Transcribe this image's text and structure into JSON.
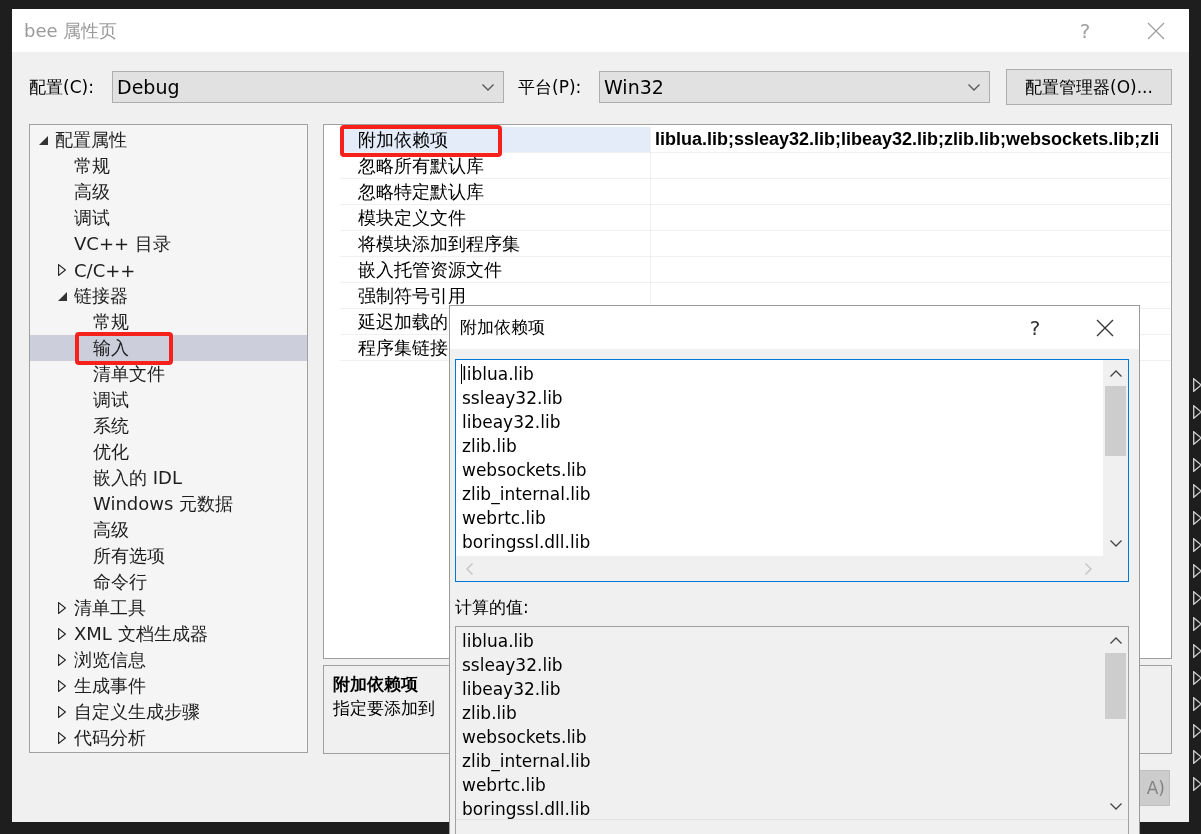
{
  "window": {
    "title": "bee 属性页",
    "help": "?"
  },
  "toolbar": {
    "config_label": "配置(C):",
    "config_value": "Debug",
    "platform_label": "平台(P):",
    "platform_value": "Win32",
    "manager_button": "配置管理器(O)..."
  },
  "tree": [
    {
      "label": "配置属性",
      "kind": "folder",
      "expanded": true,
      "selected": false,
      "annotated": false,
      "children": [
        {
          "label": "常规",
          "kind": "page",
          "selected": false,
          "annotated": false
        },
        {
          "label": "高级",
          "kind": "page",
          "selected": false,
          "annotated": false
        },
        {
          "label": "调试",
          "kind": "page",
          "selected": false,
          "annotated": false
        },
        {
          "label": "VC++ 目录",
          "kind": "page",
          "selected": false,
          "annotated": false
        },
        {
          "label": "C/C++",
          "kind": "folder",
          "expanded": false,
          "selected": false,
          "annotated": false
        },
        {
          "label": "链接器",
          "kind": "folder",
          "expanded": true,
          "selected": false,
          "annotated": false,
          "children": [
            {
              "label": "常规",
              "kind": "page",
              "selected": false,
              "annotated": false
            },
            {
              "label": "输入",
              "kind": "page",
              "selected": true,
              "annotated": true
            },
            {
              "label": "清单文件",
              "kind": "page",
              "selected": false,
              "annotated": false
            },
            {
              "label": "调试",
              "kind": "page",
              "selected": false,
              "annotated": false
            },
            {
              "label": "系统",
              "kind": "page",
              "selected": false,
              "annotated": false
            },
            {
              "label": "优化",
              "kind": "page",
              "selected": false,
              "annotated": false
            },
            {
              "label": "嵌入的 IDL",
              "kind": "page",
              "selected": false,
              "annotated": false
            },
            {
              "label": "Windows 元数据",
              "kind": "page",
              "selected": false,
              "annotated": false
            },
            {
              "label": "高级",
              "kind": "page",
              "selected": false,
              "annotated": false
            },
            {
              "label": "所有选项",
              "kind": "page",
              "selected": false,
              "annotated": false
            },
            {
              "label": "命令行",
              "kind": "page",
              "selected": false,
              "annotated": false
            }
          ]
        },
        {
          "label": "清单工具",
          "kind": "folder",
          "expanded": false,
          "selected": false,
          "annotated": false
        },
        {
          "label": "XML 文档生成器",
          "kind": "folder",
          "expanded": false,
          "selected": false,
          "annotated": false
        },
        {
          "label": "浏览信息",
          "kind": "folder",
          "expanded": false,
          "selected": false,
          "annotated": false
        },
        {
          "label": "生成事件",
          "kind": "folder",
          "expanded": false,
          "selected": false,
          "annotated": false
        },
        {
          "label": "自定义生成步骤",
          "kind": "folder",
          "expanded": false,
          "selected": false,
          "annotated": false
        },
        {
          "label": "代码分析",
          "kind": "folder",
          "expanded": false,
          "selected": false,
          "annotated": false
        }
      ]
    }
  ],
  "properties": [
    {
      "name": "附加依赖项",
      "value": "liblua.lib;ssleay32.lib;libeay32.lib;zlib.lib;websockets.lib;zli",
      "selected": true,
      "annotated": true
    },
    {
      "name": "忽略所有默认库",
      "selected": false,
      "annotated": false
    },
    {
      "name": "忽略特定默认库",
      "selected": false,
      "annotated": false
    },
    {
      "name": "模块定义文件",
      "selected": false,
      "annotated": false
    },
    {
      "name": "将模块添加到程序集",
      "selected": false,
      "annotated": false
    },
    {
      "name": "嵌入托管资源文件",
      "selected": false,
      "annotated": false
    },
    {
      "name": "强制符号引用",
      "selected": false,
      "annotated": false
    },
    {
      "name": "延迟加载的",
      "selected": false,
      "annotated": false
    },
    {
      "name": "程序集链接",
      "selected": false,
      "annotated": false
    }
  ],
  "description": {
    "title": "附加依赖项",
    "text": "指定要添加到"
  },
  "apply_button": {
    "label": "A)",
    "disabled": true
  },
  "dependencies_dialog": {
    "title": "附加依赖项",
    "help": "?",
    "edit_box": {
      "focused": true,
      "lines": [
        "liblua.lib",
        "ssleay32.lib",
        "libeay32.lib",
        "zlib.lib",
        "websockets.lib",
        "zlib_internal.lib",
        "webrtc.lib",
        "boringssl.dll.lib"
      ]
    },
    "computed_label": "计算的值:",
    "computed_lines": [
      "liblua.lib",
      "ssleay32.lib",
      "libeay32.lib",
      "zlib.lib",
      "websockets.lib",
      "zlib_internal.lib",
      "webrtc.lib",
      "boringssl.dll.lib"
    ]
  }
}
